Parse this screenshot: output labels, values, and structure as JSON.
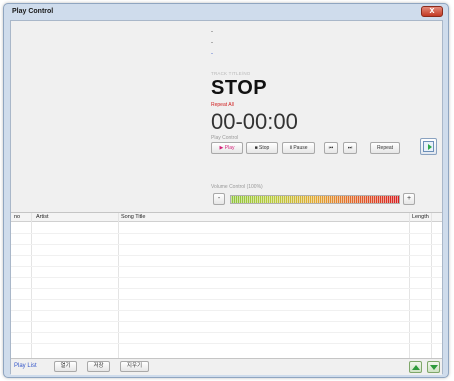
{
  "window": {
    "title": "Play Control",
    "close_glyph": "x"
  },
  "now_playing": {
    "line1": "-",
    "line2": "-",
    "line3": "-",
    "track_label": "TRACK TITLE/NO",
    "status": "STOP",
    "repeat_mode": "Repeat All",
    "time": "00-00:00"
  },
  "play_control": {
    "label": "Play Control",
    "play": "▶ Play",
    "stop": "■ Stop",
    "pause": "Ⅱ Pause",
    "prev": "⏮",
    "next": "⏭",
    "repeat": "Repeat",
    "media_icon": "media-player-icon"
  },
  "volume": {
    "label": "Volume Control (100%)",
    "level": 1.0,
    "minus": "-",
    "plus": "+"
  },
  "playlist": {
    "columns": [
      "no",
      "Artist",
      "Song Title",
      "Length"
    ],
    "label": "Play List",
    "open_button": "열기",
    "save_button": "저장",
    "delete_button": "지우기",
    "move_up_icon": "arrow-up-icon",
    "move_down_icon": "arrow-down-icon"
  },
  "colors": {
    "status_text": "#111111",
    "repeat_text": "#d02020",
    "play_text": "#d4237a",
    "playlist_label": "#3557c9",
    "arrow_green": "#2e9a3c"
  }
}
